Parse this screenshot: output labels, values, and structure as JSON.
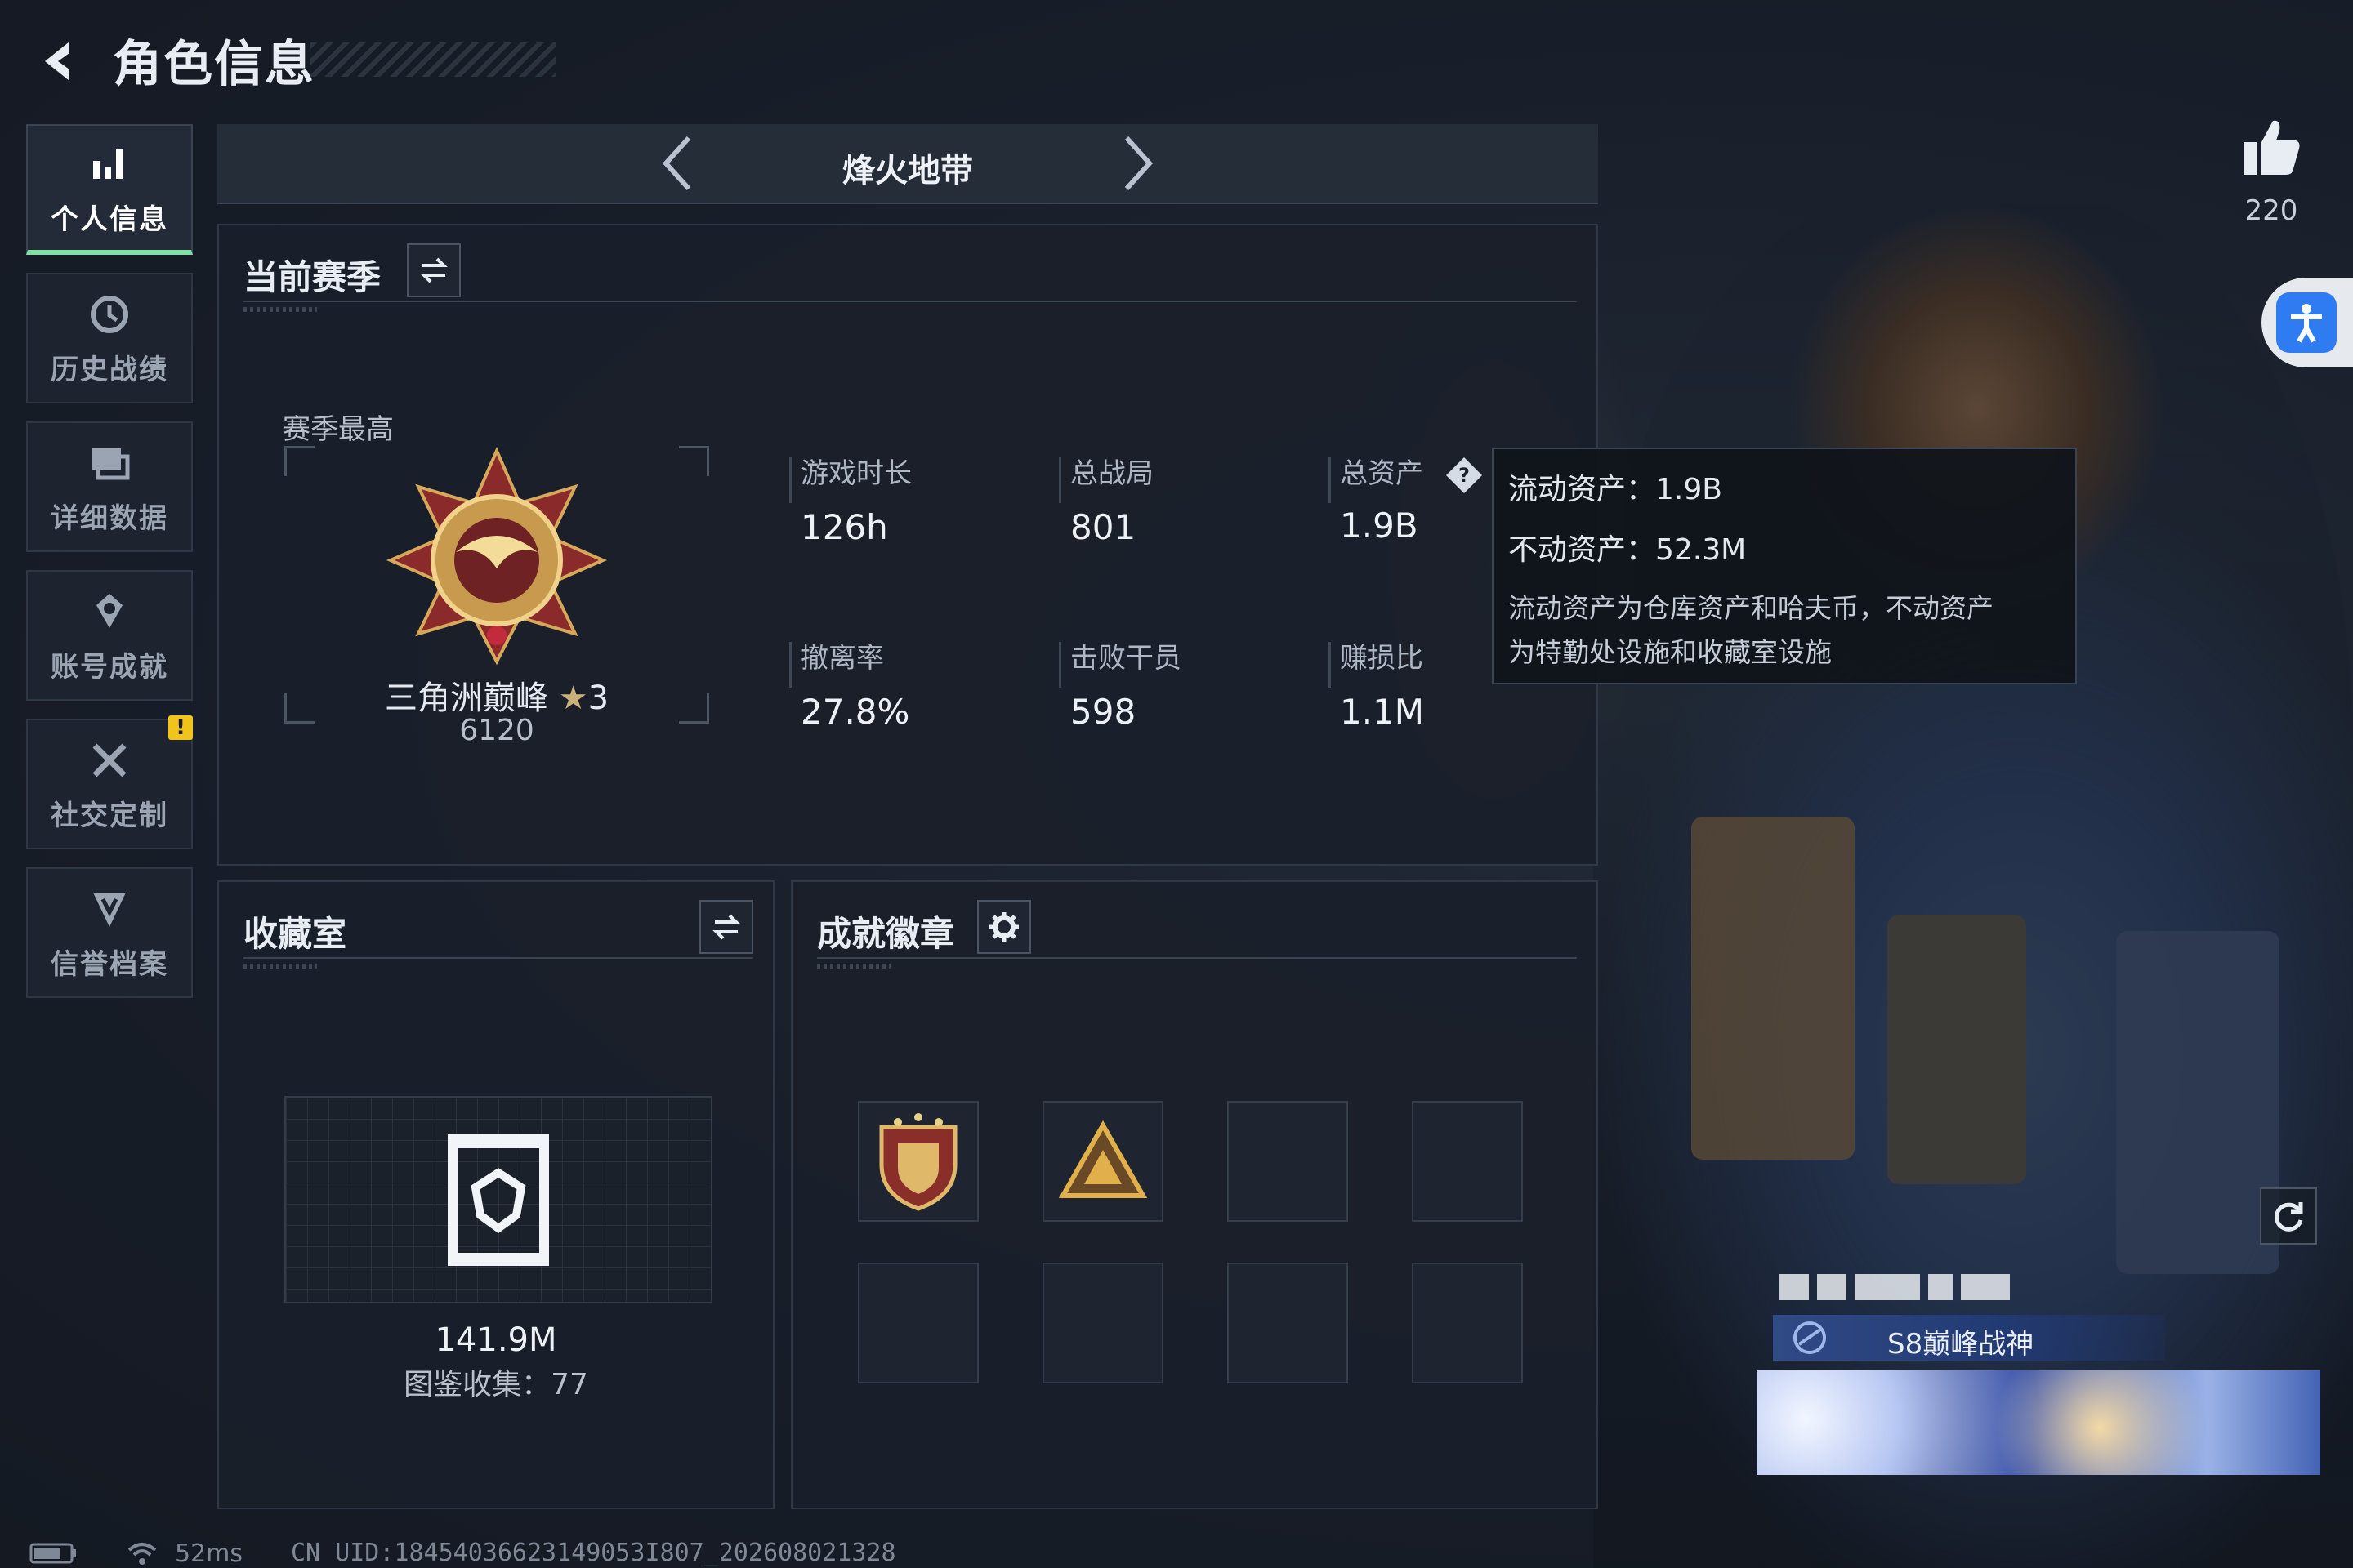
{
  "header": {
    "title": "角色信息"
  },
  "sidebar": {
    "items": [
      {
        "label": "个人信息",
        "icon": "bar-chart-icon",
        "active": true
      },
      {
        "label": "历史战绩",
        "icon": "clock-history-icon",
        "active": false
      },
      {
        "label": "详细数据",
        "icon": "data-stack-icon",
        "active": false
      },
      {
        "label": "账号成就",
        "icon": "achievement-medal-icon",
        "active": false
      },
      {
        "label": "社交定制",
        "icon": "tools-cross-icon",
        "active": false,
        "alert": "!"
      },
      {
        "label": "信誉档案",
        "icon": "shield-v-icon",
        "active": false
      }
    ]
  },
  "mode": {
    "label": "烽火地带"
  },
  "season": {
    "title": "当前赛季",
    "subtitle": "赛季最高",
    "rank_name": "三角洲巅峰",
    "rank_stars": "3",
    "rank_score": "6120",
    "stats": [
      {
        "label": "游戏时长",
        "value": "126h"
      },
      {
        "label": "总战局",
        "value": "801"
      },
      {
        "label": "总资产",
        "value": "1.9B"
      },
      {
        "label": "撤离率",
        "value": "27.8%"
      },
      {
        "label": "击败干员",
        "value": "598"
      },
      {
        "label": "赚损比",
        "value": "1.1M"
      }
    ]
  },
  "tooltip": {
    "liquid": "流动资产：1.9B",
    "fixed": "不动资产：52.3M",
    "note_line1": "流动资产为仓库资产和哈夫币，不动资产",
    "note_line2": "为特勤处设施和收藏室设施"
  },
  "collection": {
    "title": "收藏室",
    "value": "141.9M",
    "count": "图鉴收集：77"
  },
  "badges": {
    "title": "成就徽章",
    "filled": 2,
    "slots": 8
  },
  "likes": {
    "count": "220"
  },
  "player_title": {
    "text": "S8巅峰战神"
  },
  "status": {
    "ping": "52ms",
    "uid": "CN UID:18454036623149053I807_202608021328"
  },
  "colors": {
    "accent_green": "#7fe0a3",
    "warn": "#f0c419",
    "access_blue": "#2f7bf2"
  }
}
